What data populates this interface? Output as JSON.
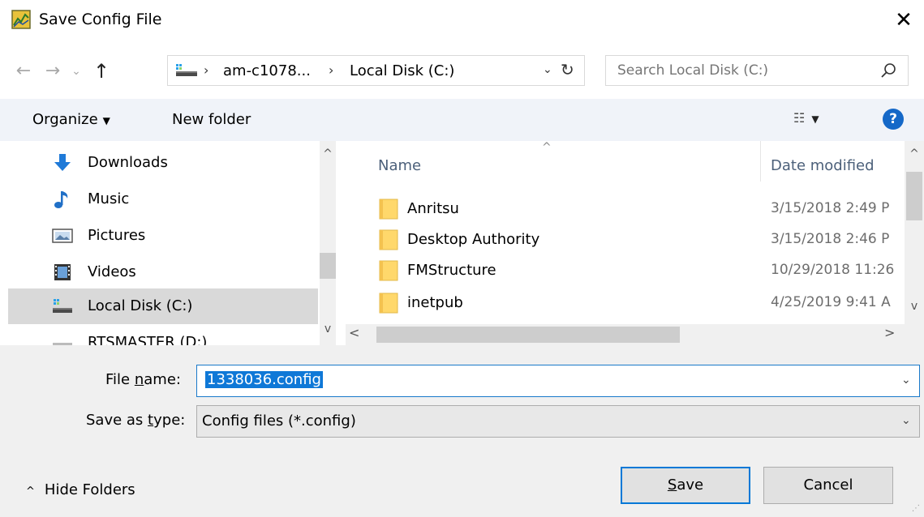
{
  "window": {
    "title": "Save Config File",
    "icon": "chart-app-icon",
    "close_glyph": "✕"
  },
  "address": {
    "back_glyph": "←",
    "forward_glyph": "→",
    "recent_glyph": "⌄",
    "up_glyph": "↑",
    "drive_icon": "network-drive-icon",
    "separator": "›",
    "crumbs": [
      "am-c1078...",
      "Local Disk (C:)"
    ],
    "dropdown_glyph": "⌄",
    "refresh_glyph": "↻"
  },
  "search": {
    "placeholder": "Search Local Disk (C:)",
    "icon": "search-icon"
  },
  "toolbar": {
    "organize_label": "Organize",
    "organize_arrow": "▼",
    "new_folder_label": "New folder",
    "view_glyph": "☷",
    "view_arrow": "▼",
    "help_glyph": "?"
  },
  "nav": {
    "items": [
      {
        "label": "Downloads",
        "icon": "download-arrow-icon"
      },
      {
        "label": "Music",
        "icon": "music-note-icon"
      },
      {
        "label": "Pictures",
        "icon": "pictures-icon"
      },
      {
        "label": "Videos",
        "icon": "film-icon"
      },
      {
        "label": "Local Disk (C:)",
        "icon": "local-disk-icon",
        "selected": true
      },
      {
        "label": "RTSMASTER (D:)",
        "icon": "drive-icon"
      }
    ],
    "scroll_up_glyph": "^",
    "scroll_down_glyph": "v"
  },
  "files": {
    "columns": [
      "Name",
      "Date modified"
    ],
    "sort_glyph": "^",
    "rows": [
      {
        "name": "Anritsu",
        "date": "3/15/2018 2:49 P"
      },
      {
        "name": "Desktop Authority",
        "date": "3/15/2018 2:46 P"
      },
      {
        "name": "FMStructure",
        "date": "10/29/2018 11:26"
      },
      {
        "name": "inetpub",
        "date": "4/25/2019 9:41 A"
      }
    ],
    "scroll_up_glyph": "^",
    "scroll_down_glyph": "v",
    "scroll_left_glyph": "<",
    "scroll_right_glyph": ">"
  },
  "form": {
    "filename_label_pre": "File ",
    "filename_label_u": "n",
    "filename_label_post": "ame:",
    "filename_value": "1338036.config",
    "savetype_label_pre": "Save as ",
    "savetype_label_u": "t",
    "savetype_label_post": "ype:",
    "savetype_value": "Config files (*.config)",
    "dropdown_glyph": "⌄"
  },
  "footer": {
    "hide_folders_arrow": "^",
    "hide_folders_label": "Hide Folders",
    "save_u": "S",
    "save_rest": "ave",
    "cancel_label": "Cancel",
    "grip_glyph": "⋰"
  },
  "colors": {
    "accent": "#0078d7",
    "selection": "#0f78d7",
    "toolbar_bg": "#f0f3f9",
    "folder_yellow": "#ffd86b",
    "header_text": "#4c607a"
  }
}
